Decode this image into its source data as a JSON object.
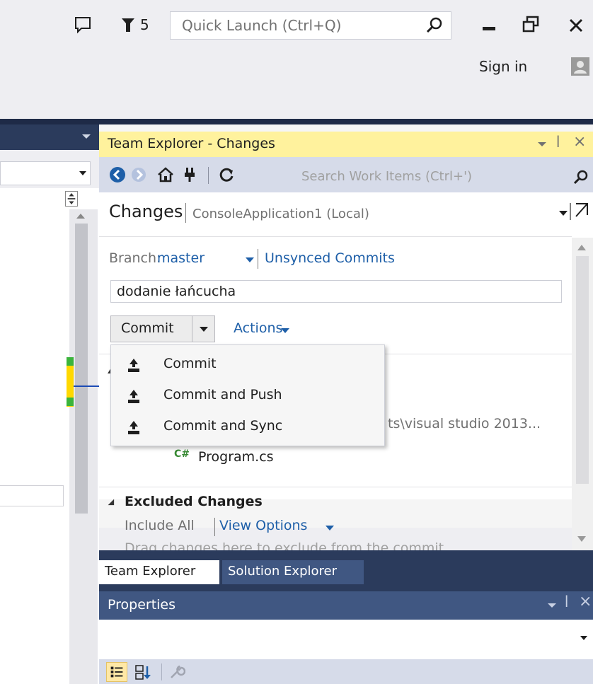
{
  "titlebar": {
    "notification_count": "5",
    "quick_launch_placeholder": "Quick Launch (Ctrl+Q)",
    "sign_in": "Sign in"
  },
  "team_explorer": {
    "title": "Team Explorer - Changes",
    "search_placeholder": "Search Work Items (Ctrl+')",
    "page_title": "Changes",
    "page_subtitle": "ConsoleApplication1 (Local)",
    "branch_label": "Branch:",
    "branch_value": "master",
    "unsynced_commits": "Unsynced Commits",
    "commit_message": "dodanie łańcucha",
    "commit_button": "Commit",
    "actions_label": "Actions",
    "path_text": "ts\\visual studio 2013...",
    "file_icon": "C#",
    "file_name": "Program.cs",
    "excluded_header": "Excluded Changes",
    "include_all": "Include All",
    "view_options": "View Options",
    "drag_hint": "Drag changes here to exclude from the commit"
  },
  "commit_menu": {
    "items": [
      {
        "label": "Commit",
        "icon": "commit-upload-icon"
      },
      {
        "label": "Commit and Push",
        "icon": "commit-upload-icon"
      },
      {
        "label": "Commit and Sync",
        "icon": "commit-upload-icon"
      }
    ]
  },
  "tabs": {
    "team_explorer": "Team Explorer",
    "solution_explorer": "Solution Explorer"
  },
  "properties": {
    "title": "Properties"
  },
  "colors": {
    "link_blue": "#1e5fa8",
    "active_title_yellow": "#fff29d",
    "navy": "#2b3b5c"
  }
}
